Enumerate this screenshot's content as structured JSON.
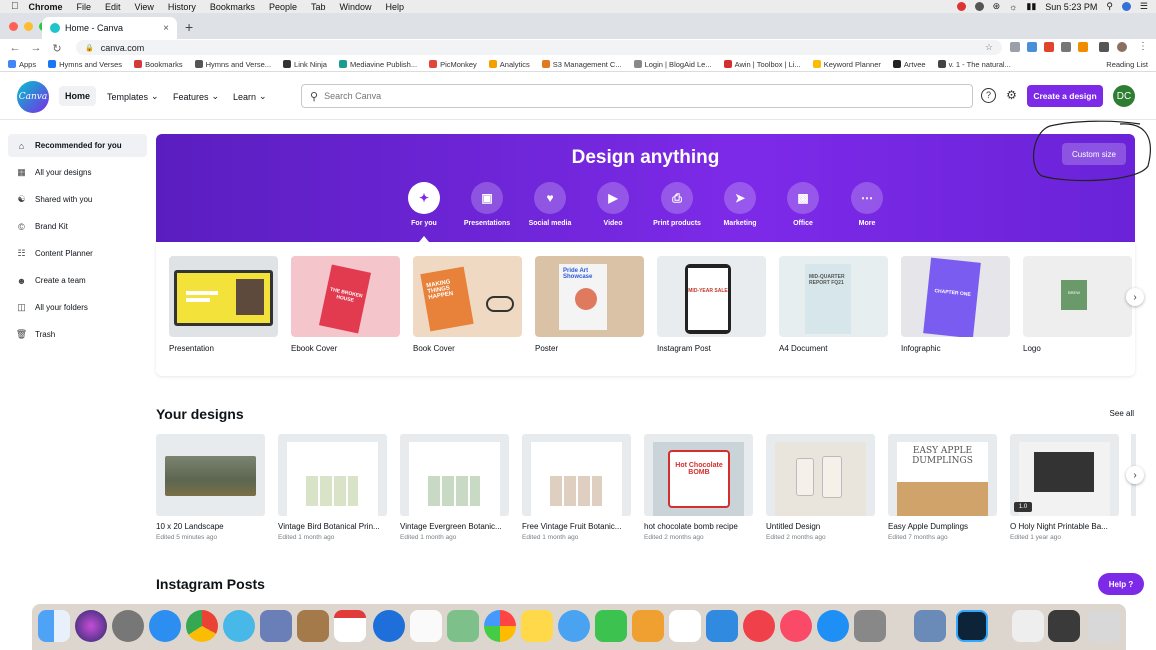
{
  "menubar": {
    "app": "Chrome",
    "menus": [
      "File",
      "Edit",
      "View",
      "History",
      "Bookmarks",
      "People",
      "Tab",
      "Window",
      "Help"
    ],
    "clock": "Sun 5:23 PM"
  },
  "browser": {
    "tab_title": "Home - Canva",
    "url": "canva.com"
  },
  "bookmarks": [
    {
      "label": "Apps",
      "color": "#4285f4"
    },
    {
      "label": "Hymns and Verses",
      "color": "#1877f2"
    },
    {
      "label": "Bookmarks",
      "color": "#d23a3a"
    },
    {
      "label": "Hymns and Verse...",
      "color": "#555555"
    },
    {
      "label": "Link Ninja",
      "color": "#333333"
    },
    {
      "label": "Mediavine Publish...",
      "color": "#1a9c8f"
    },
    {
      "label": "PicMonkey",
      "color": "#e2453c"
    },
    {
      "label": "Analytics",
      "color": "#f4a100"
    },
    {
      "label": "S3 Management C...",
      "color": "#e07a1f"
    },
    {
      "label": "Login | BlogAid Le...",
      "color": "#888888"
    },
    {
      "label": "Awin | Toolbox | Li...",
      "color": "#d32f2f"
    },
    {
      "label": "Keyword Planner",
      "color": "#fbbc04"
    },
    {
      "label": "Artvee",
      "color": "#222222"
    },
    {
      "label": "v. 1 - The natural...",
      "color": "#444444"
    }
  ],
  "reading_list": "Reading List",
  "header": {
    "logo": "Canva",
    "nav": {
      "home": "Home",
      "templates": "Templates",
      "features": "Features",
      "learn": "Learn"
    },
    "search_placeholder": "Search Canva",
    "create_label": "Create a design",
    "avatar_initials": "DC"
  },
  "sidebar": {
    "items": [
      {
        "label": "Recommended for you",
        "icon": "home-icon"
      },
      {
        "label": "All your designs",
        "icon": "grid-icon"
      },
      {
        "label": "Shared with you",
        "icon": "users-icon"
      },
      {
        "label": "Brand Kit",
        "icon": "brand-icon"
      },
      {
        "label": "Content Planner",
        "icon": "calendar-icon"
      },
      {
        "label": "Create a team",
        "icon": "team-icon"
      },
      {
        "label": "All your folders",
        "icon": "folder-icon"
      },
      {
        "label": "Trash",
        "icon": "trash-icon"
      }
    ]
  },
  "hero": {
    "title": "Design anything",
    "custom_size": "Custom size",
    "categories": [
      "For you",
      "Presentations",
      "Social media",
      "Video",
      "Print products",
      "Marketing",
      "Office",
      "More"
    ]
  },
  "recommended": [
    {
      "label": "Presentation",
      "text": ""
    },
    {
      "label": "Ebook Cover",
      "text": "THE BROKEN HOUSE"
    },
    {
      "label": "Book Cover",
      "text": "MAKING THINGS HAPPEN"
    },
    {
      "label": "Poster",
      "text": "Pride Art Showcase"
    },
    {
      "label": "Instagram Post",
      "text": "MID-YEAR SALE"
    },
    {
      "label": "A4 Document",
      "text": "MID-QUARTER REPORT FQ21"
    },
    {
      "label": "Infographic",
      "text": "CHAPTER ONE"
    },
    {
      "label": "Logo",
      "text": "BREW"
    }
  ],
  "your_designs": {
    "title": "Your designs",
    "see_all": "See all",
    "items": [
      {
        "title": "10 x 20 Landscape",
        "meta": "Edited 5 minutes ago"
      },
      {
        "title": "Vintage Bird Botanical Prin...",
        "meta": "Edited 1 month ago"
      },
      {
        "title": "Vintage Evergreen Botanic...",
        "meta": "Edited 1 month ago"
      },
      {
        "title": "Free Vintage Fruit Botanic...",
        "meta": "Edited 1 month ago"
      },
      {
        "title": "hot chocolate bomb recipe",
        "meta": "Edited 2 months ago",
        "text": "Hot Chocolate BOMB"
      },
      {
        "title": "Untitled Design",
        "meta": "Edited 2 months ago"
      },
      {
        "title": "Easy Apple Dumplings",
        "meta": "Edited 7 months ago",
        "text": "EASY APPLE DUMPLINGS"
      },
      {
        "title": "O Holy Night Printable Ba...",
        "meta": "Edited 1 year ago",
        "badge": "1.0"
      }
    ]
  },
  "instagram_title": "Instagram Posts",
  "help_label": "Help ?",
  "colors": {
    "accent": "#7d2ae8",
    "teal": "#00c4cc"
  }
}
